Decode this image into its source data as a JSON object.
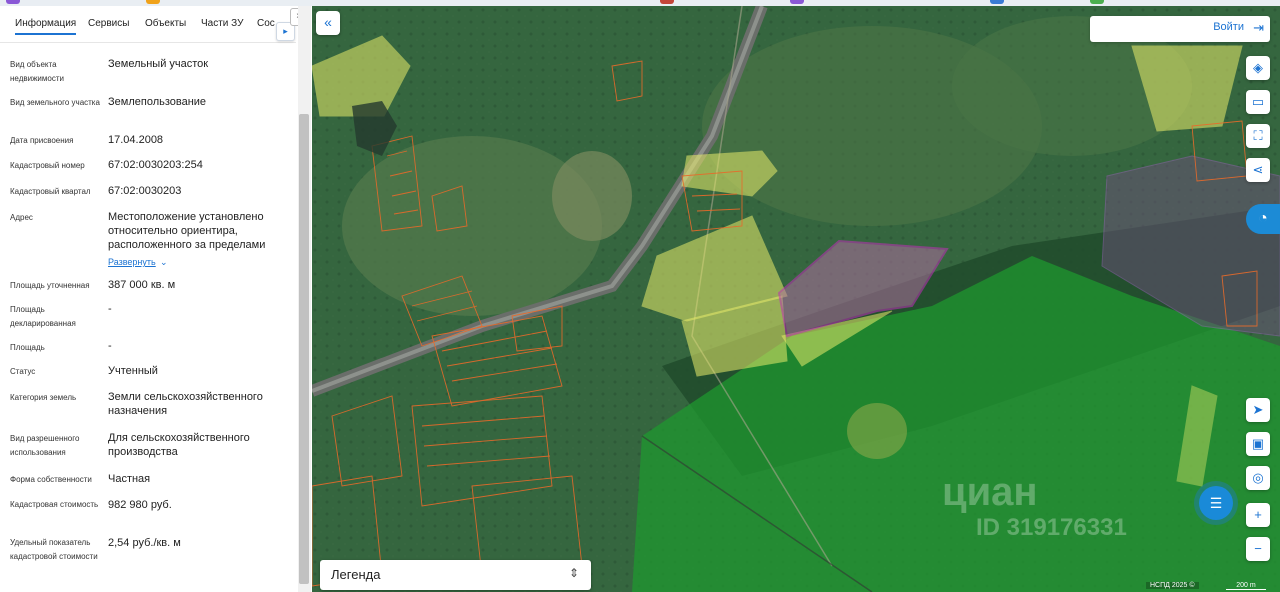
{
  "tabs": [
    {
      "label": "Информация"
    },
    {
      "label": "Сервисы"
    },
    {
      "label": "Объекты"
    },
    {
      "label": "Части ЗУ"
    },
    {
      "label": "Сос"
    }
  ],
  "tab_next_icon": "chevron-right-icon",
  "info_rows": [
    {
      "label": "Вид объекта недвижимости",
      "value": "Земельный участок"
    },
    {
      "label": "Вид земельного участка",
      "value": "Землепользование"
    },
    {
      "label": "Дата присвоения",
      "value": "17.04.2008"
    },
    {
      "label": "Кадастровый номер",
      "value": "67:02:0030203:254"
    },
    {
      "label": "Кадастровый квартал",
      "value": "67:02:0030203"
    },
    {
      "label": "Адрес",
      "value": "Местоположение установлено относительно ориентира, расположенного за пределами"
    },
    {
      "label": "Площадь уточненная",
      "value": "387 000 кв. м"
    },
    {
      "label": "Площадь декларированная",
      "value": "-"
    },
    {
      "label": "Площадь",
      "value": "-"
    },
    {
      "label": "Статус",
      "value": "Учтенный"
    },
    {
      "label": "Категория земель",
      "value": "Земли сельскохозяйственного назначения"
    },
    {
      "label": "Вид разрешенного использования",
      "value": "Для сельскохозяйственного производства"
    },
    {
      "label": "Форма собственности",
      "value": "Частная"
    },
    {
      "label": "Кадастровая стоимость",
      "value": "982 980 руб."
    },
    {
      "label": "Удельный показатель кадастровой стоимости",
      "value": "2,54 руб./кв. м"
    }
  ],
  "address_expand": "Развернуть",
  "map": {
    "collapse_icon": "double-chevron-left-icon",
    "login_label": "Войти",
    "legend_label": "Легенда",
    "watermark_brand": "циан",
    "watermark_id": "ID 319176331",
    "attribution": "НСПД 2025 ©",
    "scale_label": "200 m",
    "controls_top": [
      "layers-icon",
      "ruler-icon",
      "select-area-icon",
      "share-icon"
    ],
    "controls_bottom": [
      "navigate-icon",
      "screen-icon",
      "location-icon"
    ],
    "zoom_in": "+",
    "zoom_out": "−",
    "colors": {
      "accent": "#1c73d2",
      "forest_zone": "#1f9a2f",
      "highlight_parcel": "#c02fb8",
      "parcel_yellow": "#e8ec6a",
      "parcel_orange": "#e86a2a"
    }
  }
}
